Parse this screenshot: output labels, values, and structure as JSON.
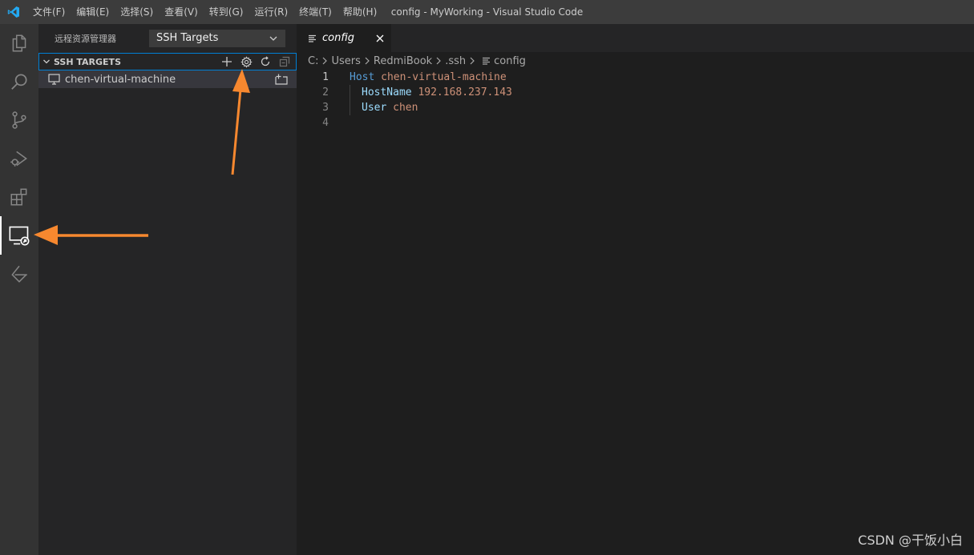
{
  "titlebar": {
    "menu": [
      "文件(F)",
      "编辑(E)",
      "选择(S)",
      "查看(V)",
      "转到(G)",
      "运行(R)",
      "终端(T)",
      "帮助(H)"
    ],
    "window_title": "config - MyWorking - Visual Studio Code"
  },
  "activitybar": {
    "items": [
      "explorer-icon",
      "search-icon",
      "source-control-icon",
      "run-debug-icon",
      "extensions-icon",
      "remote-explorer-icon",
      "remote-extension-icon"
    ],
    "active": "remote-explorer-icon"
  },
  "sidebar": {
    "title": "远程资源管理器",
    "target_select": "SSH Targets",
    "section_title": "SSH TARGETS",
    "hosts": [
      "chen-virtual-machine"
    ]
  },
  "editor": {
    "tab_label": "config",
    "breadcrumb": [
      "C:",
      "Users",
      "RedmiBook",
      ".ssh",
      "config"
    ],
    "lines": [
      {
        "num": "1",
        "key": "Host",
        "value": "chen-virtual-machine"
      },
      {
        "num": "2",
        "key": "HostName",
        "value": "192.168.237.143"
      },
      {
        "num": "3",
        "key": "User",
        "value": "chen"
      },
      {
        "num": "4",
        "key": "",
        "value": ""
      }
    ]
  },
  "watermark": "CSDN @干饭小白",
  "colors": {
    "accent": "#007acc",
    "annotation_arrow": "#f7882f",
    "keyword": "#569cd6",
    "string": "#ce9178"
  }
}
